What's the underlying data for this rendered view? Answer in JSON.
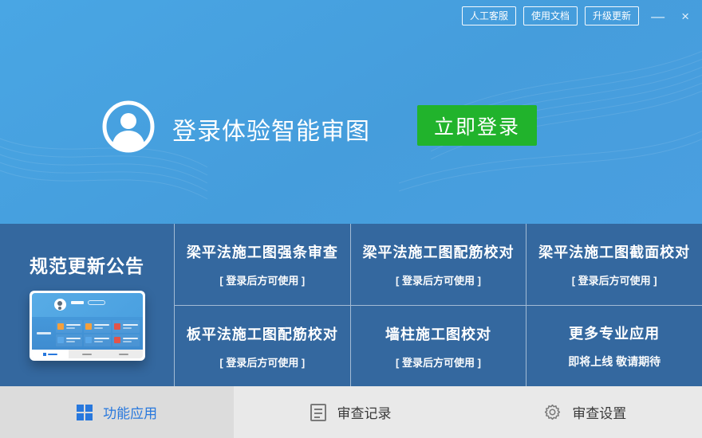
{
  "topbar": {
    "buttons": [
      {
        "label": "人工客服"
      },
      {
        "label": "使用文档"
      },
      {
        "label": "升级更新"
      }
    ],
    "minimize_glyph": "—",
    "close_glyph": "×"
  },
  "hero": {
    "title": "登录体验智能审图",
    "login_button": "立即登录"
  },
  "announcement": {
    "title": "规范更新公告"
  },
  "features": [
    {
      "title": "梁平法施工图强条审查",
      "subtitle": "[ 登录后方可使用 ]"
    },
    {
      "title": "梁平法施工图配筋校对",
      "subtitle": "[ 登录后方可使用 ]"
    },
    {
      "title": "梁平法施工图截面校对",
      "subtitle": "[ 登录后方可使用 ]"
    },
    {
      "title": "板平法施工图配筋校对",
      "subtitle": "[ 登录后方可使用 ]"
    },
    {
      "title": "墙柱施工图校对",
      "subtitle": "[ 登录后方可使用 ]"
    },
    {
      "title": "更多专业应用",
      "subtitle": "即将上线 敬请期待"
    }
  ],
  "tabs": [
    {
      "label": "功能应用",
      "active": true
    },
    {
      "label": "审查记录",
      "active": false
    },
    {
      "label": "审查设置",
      "active": false
    }
  ],
  "icons": {
    "avatar": "person-circle",
    "tab_apps": "grid-2x2",
    "tab_records": "document-list",
    "tab_settings": "gear"
  },
  "colors": {
    "hero_blue": "#47a1de",
    "panel_blue": "#34689f",
    "login_green": "#21b32c",
    "accent_blue": "#2878dd",
    "tabbar_gray": "#e9e9e9",
    "tab_active_gray": "#dcdcdc"
  }
}
